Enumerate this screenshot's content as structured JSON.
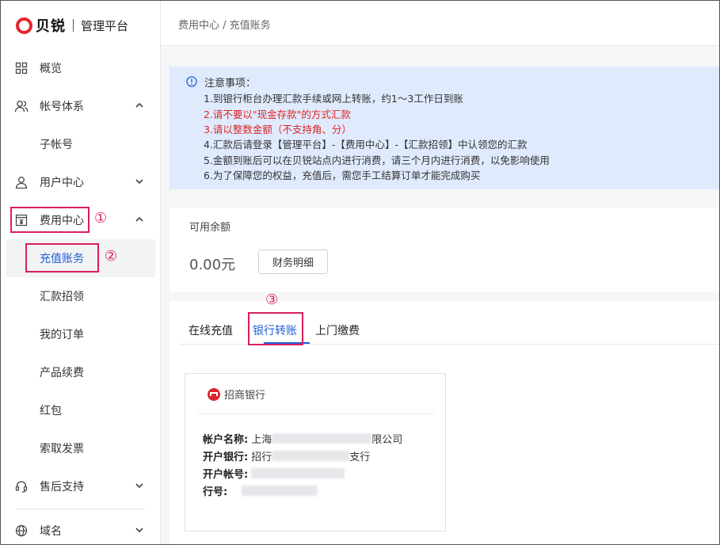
{
  "logo": {
    "brand": "贝锐",
    "subtitle": "管理平台"
  },
  "sidebar": {
    "items": [
      {
        "label": "概览",
        "icon": "grid-icon"
      },
      {
        "label": "帐号体系",
        "icon": "users-icon",
        "chevron": "up"
      },
      {
        "label": "子帐号"
      },
      {
        "label": "用户中心",
        "icon": "user-icon",
        "chevron": "down"
      },
      {
        "label": "费用中心",
        "icon": "bill-icon",
        "chevron": "up"
      },
      {
        "label": "充值账务",
        "selected": true
      },
      {
        "label": "汇款招领"
      },
      {
        "label": "我的订单"
      },
      {
        "label": "产品续费"
      },
      {
        "label": "红包"
      },
      {
        "label": "索取发票"
      },
      {
        "label": "售后支持",
        "icon": "headset-icon",
        "chevron": "down"
      },
      {
        "label": "域名",
        "icon": "globe-icon",
        "chevron": "down"
      }
    ]
  },
  "annotations": {
    "one": "①",
    "two": "②",
    "three": "③"
  },
  "breadcrumb": "费用中心 / 充值账务",
  "notice": {
    "title": "注意事项：",
    "lines": [
      "1.到银行柜台办理汇款手续或网上转账，约1～3工作日到账",
      "2.请不要以\"现金存款\"的方式汇款",
      "3.请以整数金额（不支持角、分）",
      "4.汇款后请登录【管理平台】-【费用中心】-【汇款招领】中认领您的汇款",
      "5.金额到账后可以在贝锐站点内进行消费，请三个月内进行消费，以免影响使用",
      "6.为了保障您的权益，充值后，需您手工结算订单才能完成购买"
    ]
  },
  "balance": {
    "label": "可用余额",
    "value": "0.00元",
    "details_button": "财务明细"
  },
  "tabs": [
    "在线充值",
    "银行转账",
    "上门缴费"
  ],
  "bank_card": {
    "bank_name": "招商银行",
    "account_name_label": "帐户名称:",
    "account_name_prefix": "上海",
    "account_name_suffix": "限公司",
    "bank_label": "开户银行:",
    "bank_prefix": "招行",
    "bank_suffix": "支行",
    "account_no_label": "开户帐号:",
    "row_no_label": "行号:"
  },
  "colors": {
    "accent": "#1f5fd6",
    "annotation": "#d8205b",
    "notice_bg": "#dfeafd",
    "warning_text": "#e02424",
    "brand": "#e4262e"
  }
}
